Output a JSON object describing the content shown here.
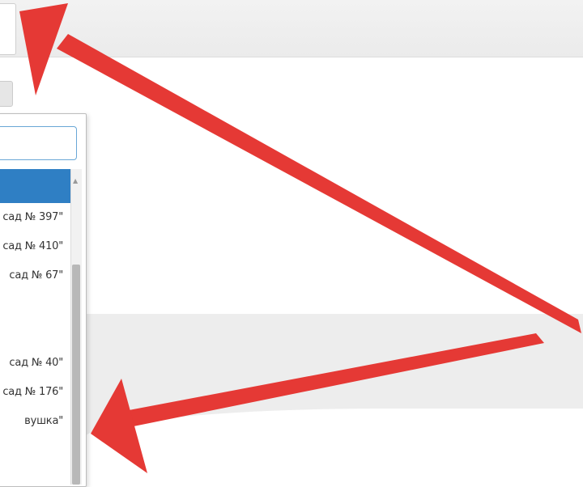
{
  "dropdown": {
    "search_value": "",
    "items": [
      {
        "label": ""
      },
      {
        "label": "сад № 397\""
      },
      {
        "label": "сад № 410\""
      },
      {
        "label": "сад № 67\""
      },
      {
        "label": ""
      },
      {
        "label": ""
      },
      {
        "label": "сад № 40\""
      },
      {
        "label": "сад № 176\""
      },
      {
        "label": "вушка\""
      }
    ]
  },
  "colors": {
    "arrow": "#e53935",
    "selection": "#2f7fc4",
    "search_border": "#69a7d6"
  }
}
